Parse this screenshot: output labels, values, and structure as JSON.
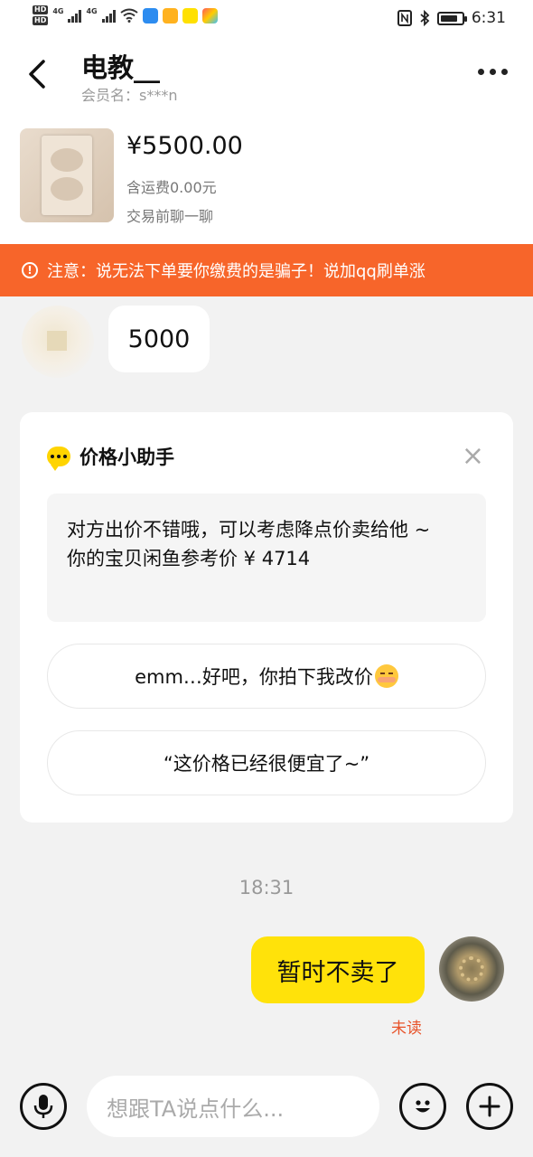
{
  "status_bar": {
    "hd1": "HD",
    "hd2": "HD",
    "net1": "4G",
    "net2": "4G",
    "time": "6:31"
  },
  "header": {
    "title": "电教__",
    "member_name": "会员名：s***n"
  },
  "product": {
    "price": "¥5500.00",
    "shipping": "含运费0.00元",
    "hint": "交易前聊一聊"
  },
  "warning": {
    "text": "注意：说无法下单要你缴费的是骗子！说加qq刷单涨"
  },
  "messages": {
    "incoming": "5000",
    "time": "18:31",
    "outgoing": "暂时不卖了",
    "read_status": "未读"
  },
  "assistant": {
    "title": "价格小助手",
    "suggestion_line1": "对方出价不错哦，可以考虑降点价卖给他 ~",
    "suggestion_line2": "你的宝贝闲鱼参考价 ¥ 4714",
    "option1": "emm…好吧，你拍下我改价",
    "option2": "“这价格已经很便宜了~”"
  },
  "input": {
    "placeholder": "想跟TA说点什么..."
  },
  "colors": {
    "accent_yellow": "#ffe20a",
    "warning_orange": "#f7652a",
    "unread_red": "#e8542b"
  },
  "icons": [
    "back-arrow-icon",
    "more-icon",
    "warning-icon",
    "chat-bubble-icon",
    "close-icon",
    "microphone-icon",
    "smile-icon",
    "plus-icon"
  ]
}
